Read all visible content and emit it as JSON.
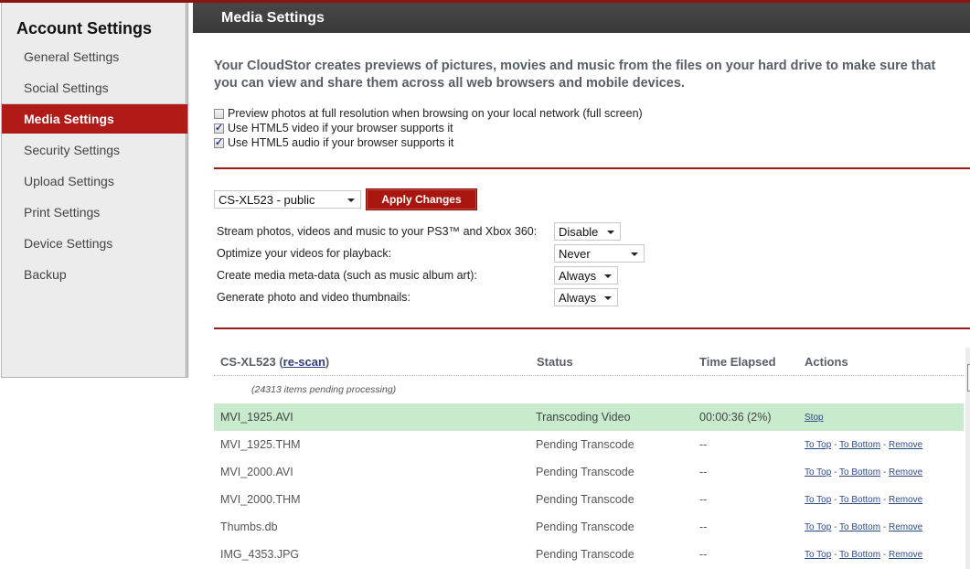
{
  "sidebar": {
    "title": "Account Settings",
    "items": [
      {
        "label": "General Settings",
        "active": false
      },
      {
        "label": "Social Settings",
        "active": false
      },
      {
        "label": "Media Settings",
        "active": true
      },
      {
        "label": "Security Settings",
        "active": false
      },
      {
        "label": "Upload Settings",
        "active": false
      },
      {
        "label": "Print Settings",
        "active": false
      },
      {
        "label": "Device Settings",
        "active": false
      },
      {
        "label": "Backup",
        "active": false
      }
    ]
  },
  "header": {
    "title": "Media Settings"
  },
  "intro": {
    "line1": "Your CloudStor creates previews of pictures, movies and music from the files on your hard drive to make sure that",
    "line2": "you can view and share them across all web browsers and mobile devices."
  },
  "checkboxes": [
    {
      "label": "Preview photos at full resolution when browsing on your local network (full screen)",
      "checked": false
    },
    {
      "label": "Use HTML5 video if your browser supports it",
      "checked": true
    },
    {
      "label": "Use HTML5 audio if your browser supports it",
      "checked": true
    }
  ],
  "share_select": {
    "value": "CS-XL523 - public"
  },
  "apply_button": {
    "label": "Apply Changes"
  },
  "options": [
    {
      "label": "Stream photos, videos and music to your PS3™ and Xbox 360:",
      "value": "Disable"
    },
    {
      "label": "Optimize your videos for playback:",
      "value": "Never"
    },
    {
      "label": "Create media meta-data (such as music album art):",
      "value": "Always"
    },
    {
      "label": "Generate photo and video thumbnails:",
      "value": "Always"
    }
  ],
  "table": {
    "device": "CS-XL523",
    "rescan_label": "re-scan",
    "columns": {
      "status": "Status",
      "time": "Time Elapsed",
      "actions": "Actions"
    },
    "pending_note": "(24313 items pending processing)",
    "rows": [
      {
        "name": "MVI_1925.AVI",
        "status": "Transcoding Video",
        "time": "00:00:36 (2%)",
        "progress_percent": 2,
        "active": true,
        "stop_label": "Stop"
      },
      {
        "name": "MVI_1925.THM",
        "status": "Pending Transcode",
        "time": "--",
        "active": false
      },
      {
        "name": "MVI_2000.AVI",
        "status": "Pending Transcode",
        "time": "--",
        "active": false
      },
      {
        "name": "MVI_2000.THM",
        "status": "Pending Transcode",
        "time": "--",
        "active": false
      },
      {
        "name": "Thumbs.db",
        "status": "Pending Transcode",
        "time": "--",
        "active": false
      },
      {
        "name": "IMG_4353.JPG",
        "status": "Pending Transcode",
        "time": "--",
        "active": false
      }
    ],
    "action_labels": {
      "to_top": "To Top",
      "to_bottom": "To Bottom",
      "remove": "Remove",
      "separator": "-"
    }
  },
  "colors": {
    "accent_red": "#b01a17",
    "header_dark": "#3f3f3f",
    "active_row_green": "#c7ebcc",
    "link_blue": "#2f4a85"
  }
}
